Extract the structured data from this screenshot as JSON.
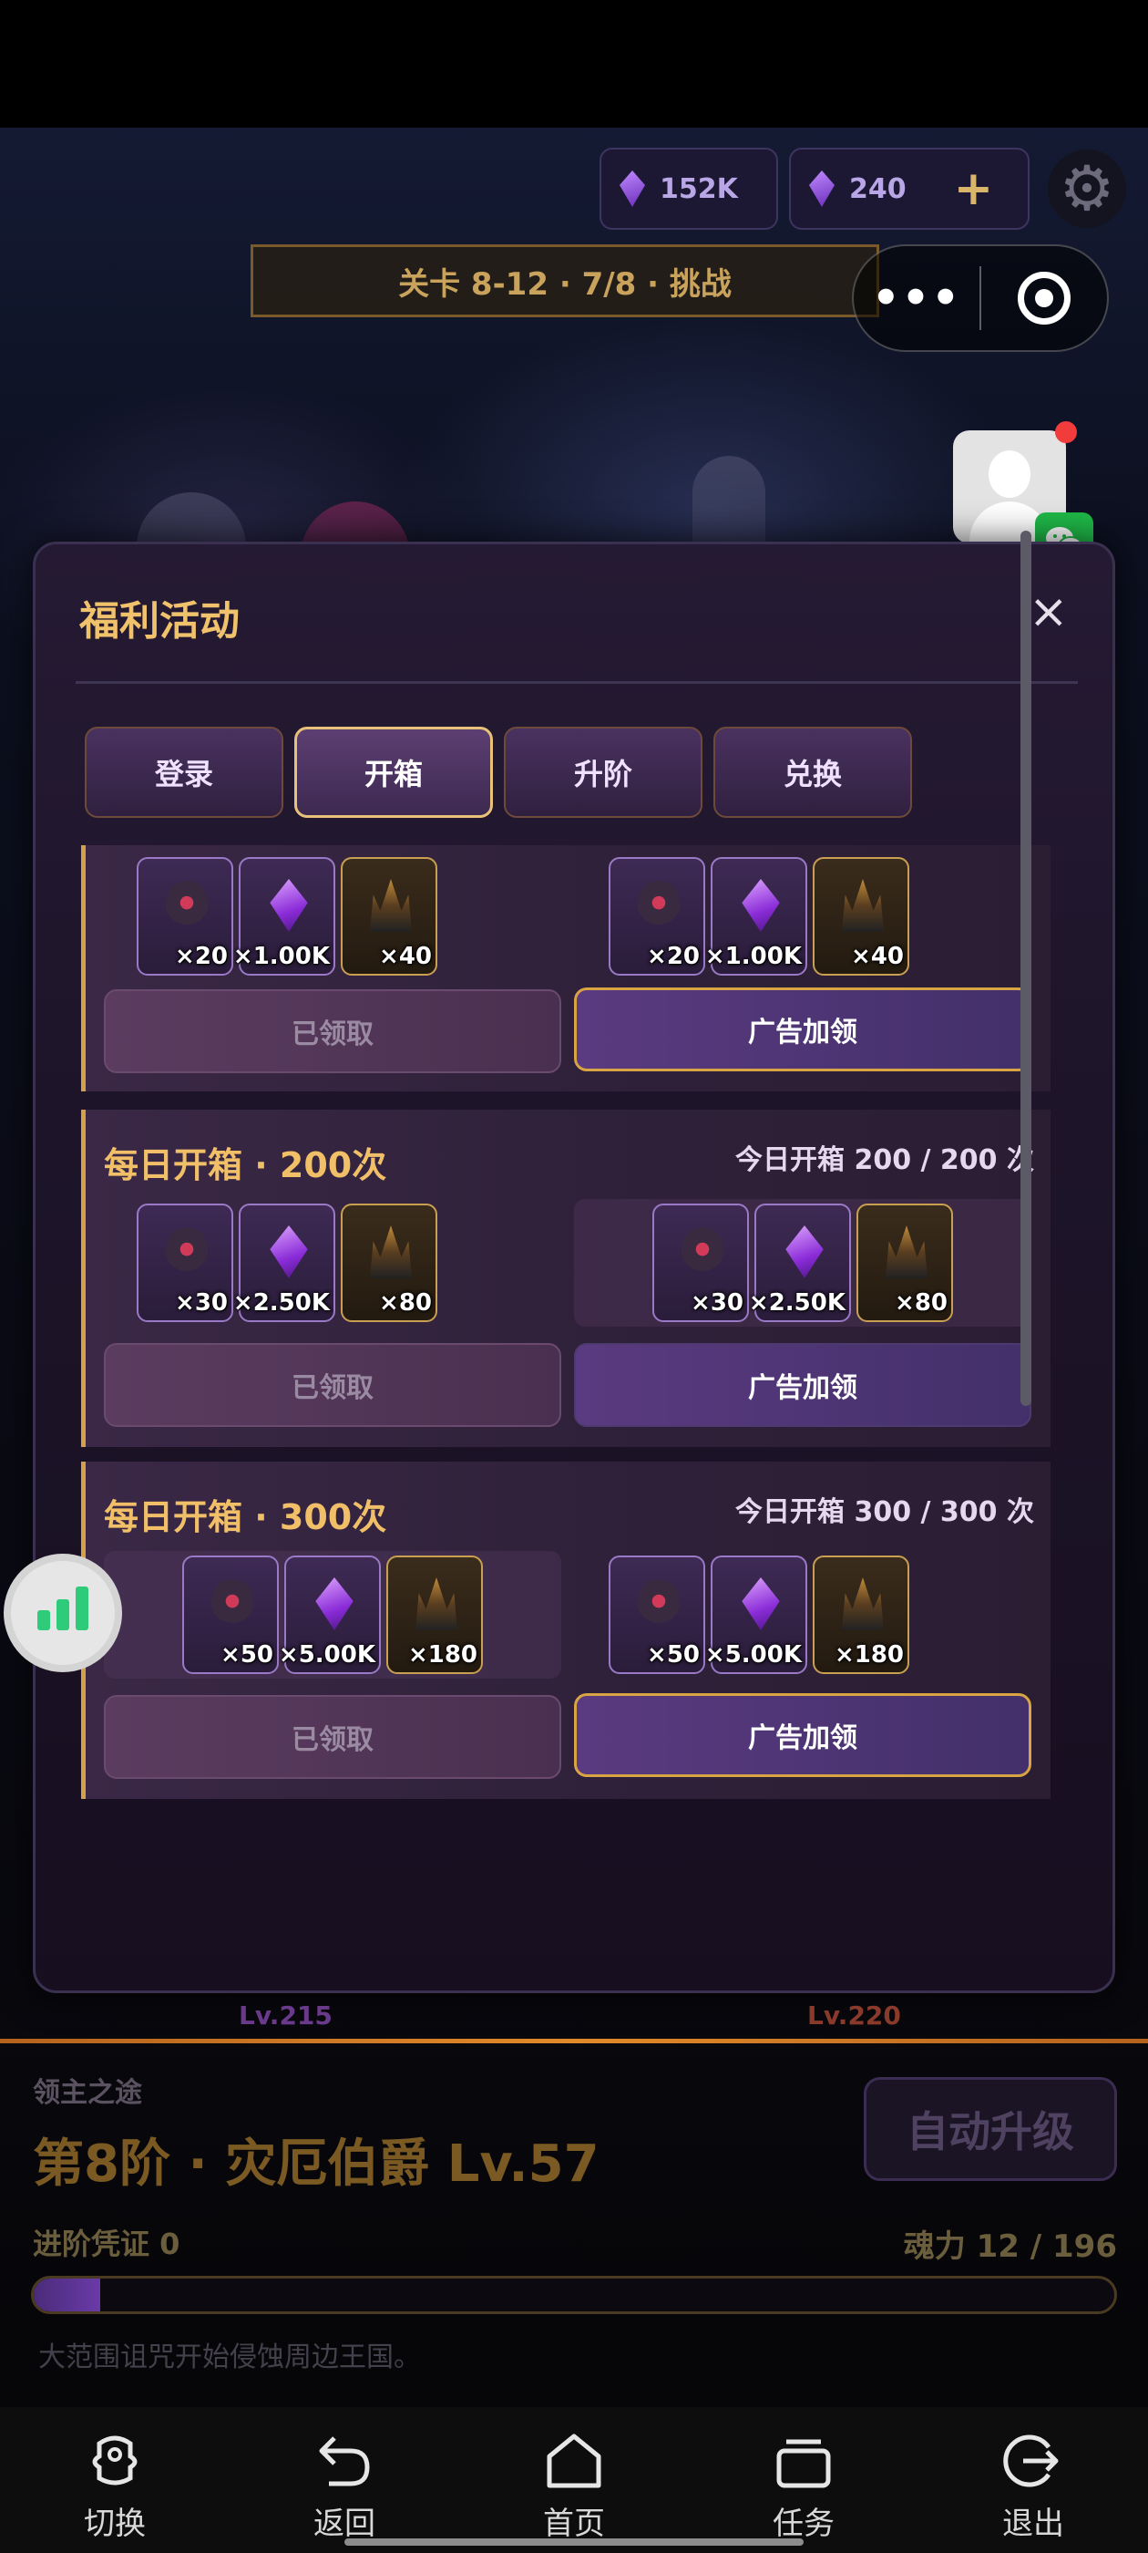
{
  "hud": {
    "resource1_value": "152K",
    "resource2_value": "240",
    "add_label": "+",
    "stage_label": "关卡 8-12 · 7/8 · 挑战",
    "capsule_more": "•••"
  },
  "modal": {
    "title": "福利活动",
    "close_label": "×",
    "tabs": [
      {
        "label": "登录",
        "active": false
      },
      {
        "label": "开箱",
        "active": true
      },
      {
        "label": "升阶",
        "active": false
      },
      {
        "label": "兑换",
        "active": false
      }
    ],
    "cards": [
      {
        "title": "",
        "progress": "",
        "left_items": [
          "×20",
          "×1.00K",
          "×40"
        ],
        "right_items": [
          "×20",
          "×1.00K",
          "×40"
        ],
        "claimed_label": "已领取",
        "ad_label": "广告加领"
      },
      {
        "title": "每日开箱 · 200次",
        "progress": "今日开箱 200 / 200 次",
        "left_items": [
          "×30",
          "×2.50K",
          "×80"
        ],
        "right_items": [
          "×30",
          "×2.50K",
          "×80"
        ],
        "claimed_label": "已领取",
        "ad_label": "广告加领"
      },
      {
        "title": "每日开箱 · 300次",
        "progress": "今日开箱 300 / 300 次",
        "left_items": [
          "×50",
          "×5.00K",
          "×180"
        ],
        "right_items": [
          "×50",
          "×5.00K",
          "×180"
        ],
        "claimed_label": "已领取",
        "ad_label": "广告加领"
      }
    ]
  },
  "game_panel": {
    "lv_left": "Lv.215",
    "lv_right": "Lv.220",
    "section_label": "领主之途",
    "rank_title": "第8阶 · 灾厄伯爵 Lv.57",
    "auto_upgrade_label": "自动升级",
    "voucher_label": "进阶凭证 0",
    "soul_label": "魂力 12 / 196",
    "soul_progress": 0.0612,
    "story_text": "大范围诅咒开始侵蚀周边王国。"
  },
  "nav": {
    "switch_label": "切换",
    "back_label": "返回",
    "home_label": "首页",
    "tasks_label": "任务",
    "exit_label": "退出"
  },
  "colors": {
    "accent_gold": "#f0bf68",
    "tab_active_border": "#e9c27a",
    "soul_bar_fill": "#6a3aa8"
  },
  "icons": [
    "gear-icon",
    "more-dots-icon",
    "target-icon",
    "avatar-icon",
    "wechat-icon",
    "stats-bars-icon",
    "switch-icon",
    "back-icon",
    "home-icon",
    "tasks-icon",
    "exit-icon"
  ]
}
